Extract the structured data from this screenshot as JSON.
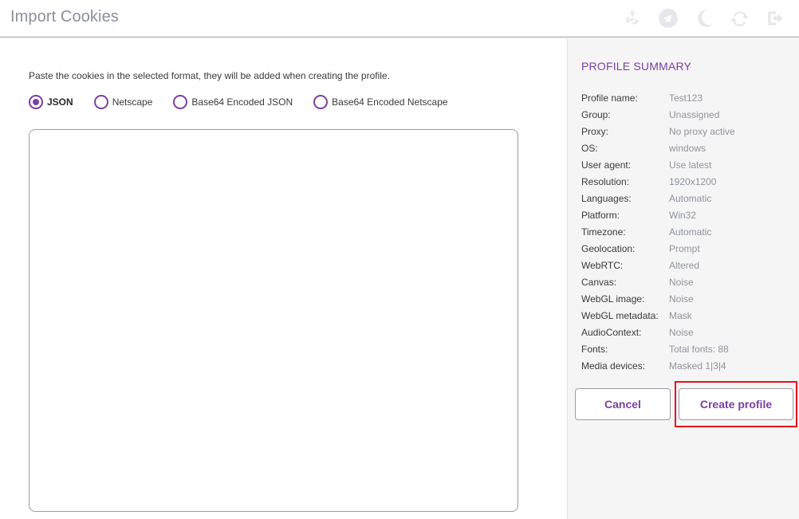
{
  "header": {
    "title": "Import Cookies",
    "icons": [
      "recycle-icon",
      "telegram-icon",
      "moon-icon",
      "refresh-icon",
      "logout-icon"
    ]
  },
  "main": {
    "instruction": "Paste the cookies in the selected format, they will be added when creating the profile.",
    "formats": [
      {
        "label": "JSON",
        "selected": true
      },
      {
        "label": "Netscape",
        "selected": false
      },
      {
        "label": "Base64 Encoded JSON",
        "selected": false
      },
      {
        "label": "Base64 Encoded Netscape",
        "selected": false
      }
    ],
    "cookie_input_value": ""
  },
  "summary": {
    "title": "PROFILE SUMMARY",
    "rows": [
      {
        "key": "Profile name:",
        "value": "Test123"
      },
      {
        "key": "Group:",
        "value": "Unassigned"
      },
      {
        "key": "Proxy:",
        "value": "No proxy active"
      },
      {
        "key": "OS:",
        "value": "windows"
      },
      {
        "key": "User agent:",
        "value": "Use latest"
      },
      {
        "key": "Resolution:",
        "value": "1920x1200"
      },
      {
        "key": "Languages:",
        "value": "Automatic"
      },
      {
        "key": "Platform:",
        "value": "Win32"
      },
      {
        "key": "Timezone:",
        "value": "Automatic"
      },
      {
        "key": "Geolocation:",
        "value": "Prompt"
      },
      {
        "key": "WebRTC:",
        "value": "Altered"
      },
      {
        "key": "Canvas:",
        "value": "Noise"
      },
      {
        "key": "WebGL image:",
        "value": "Noise"
      },
      {
        "key": "WebGL metadata:",
        "value": "Mask"
      },
      {
        "key": "AudioContext:",
        "value": "Noise"
      },
      {
        "key": "Fonts:",
        "value": "Total fonts: 88"
      },
      {
        "key": "Media devices:",
        "value": "Masked 1|3|4"
      }
    ],
    "cancel_label": "Cancel",
    "create_label": "Create profile"
  },
  "colors": {
    "accent": "#7b3fa0",
    "highlight": "#e3141d"
  }
}
